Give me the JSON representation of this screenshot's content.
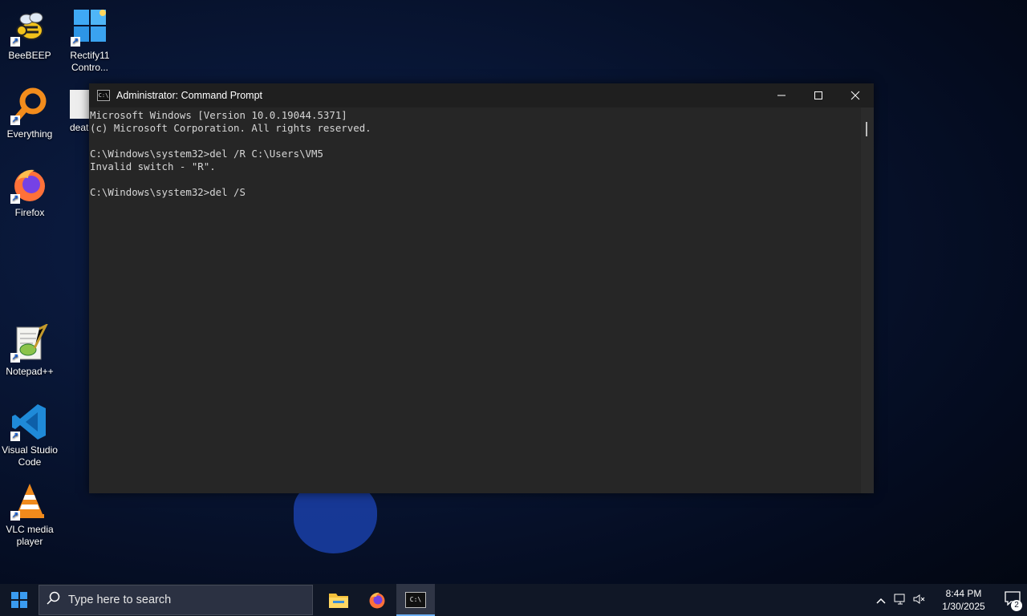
{
  "desktop": {
    "icons": [
      {
        "label": "BeeBEEP"
      },
      {
        "label": "Rectify11 Contro..."
      },
      {
        "label": "Everything"
      },
      {
        "label": "deat"
      },
      {
        "label": "Firefox"
      },
      {
        "label": "Notepad++"
      },
      {
        "label": "Visual Studio Code"
      },
      {
        "label": "VLC media player"
      }
    ]
  },
  "window": {
    "title": "Administrator: Command Prompt",
    "icon_text": "C:\\",
    "console_text": "Microsoft Windows [Version 10.0.19044.5371]\n(c) Microsoft Corporation. All rights reserved.\n\nC:\\Windows\\system32>del /R C:\\Users\\VM5\nInvalid switch - \"R\".\n\nC:\\Windows\\system32>del /S"
  },
  "taskbar": {
    "search_placeholder": "Type here to search",
    "cmd_icon_text": "C:\\",
    "time": "8:44 PM",
    "date": "1/30/2025",
    "notification_count": "2"
  },
  "colors": {
    "accent": "#3a9bf0",
    "console_bg": "#262626",
    "titlebar_bg": "#1f1f1f",
    "taskbar_bg": "#101726"
  }
}
